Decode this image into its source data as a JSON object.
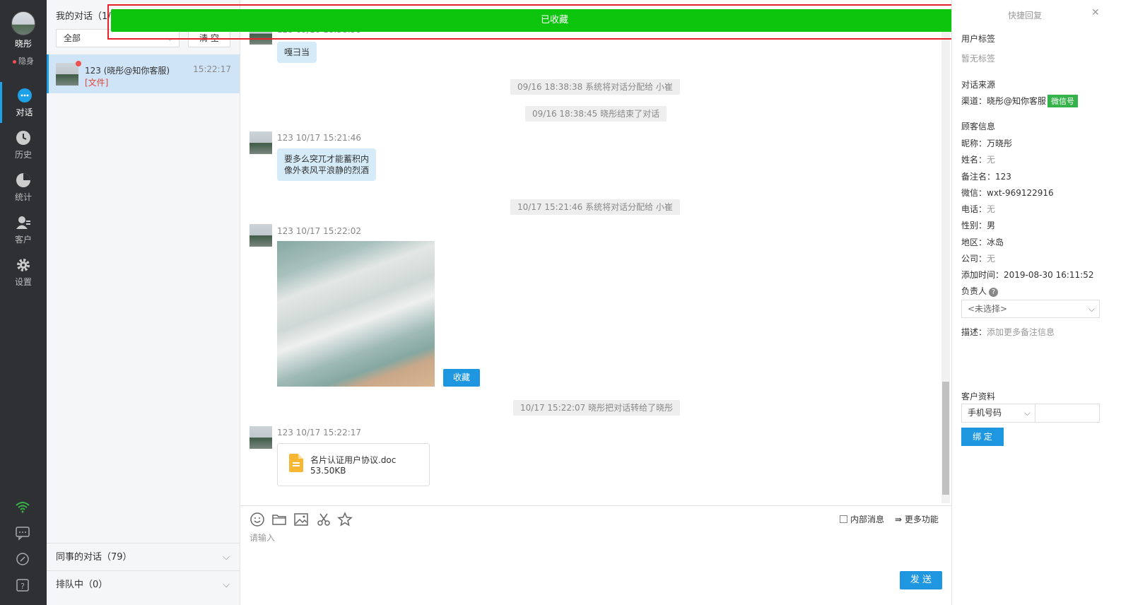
{
  "nav": {
    "user_name": "晓彤",
    "user_status": "隐身",
    "items": [
      {
        "label": "对话",
        "icon": "chat-bubble-icon"
      },
      {
        "label": "历史",
        "icon": "clock-icon"
      },
      {
        "label": "统计",
        "icon": "pie-chart-icon"
      },
      {
        "label": "客户",
        "icon": "customer-icon"
      },
      {
        "label": "设置",
        "icon": "gear-icon"
      }
    ],
    "bottom_icons": [
      "wifi-icon",
      "message-icon",
      "link-icon",
      "help-icon"
    ]
  },
  "convlist": {
    "title": "我的对话（1/",
    "filter_value": "全部",
    "clear_label": "清 空",
    "item": {
      "name": "123 (晓彤@知你客服)",
      "subtitle": "[文件]",
      "time": "15:22:17"
    },
    "colleague_label": "同事的对话（79）",
    "queue_label": "排队中（0）"
  },
  "toast": {
    "text": "已收藏",
    "color": "#0ec50e"
  },
  "chat": {
    "top_bubble": "嘎彐当",
    "top_meta_fragment": "123 09/16 18:38:38",
    "sys1": "09/16 18:38:38 系统将对话分配给 小崔",
    "sys2": "09/16 18:38:45 晓彤结束了对话",
    "msg1_meta": "123 10/17 15:21:46",
    "msg1_text_line1": "要多么突兀才能蓄积内",
    "msg1_text_line2": "像外表风平浪静的烈酒",
    "sys3": "10/17 15:21:46 系统将对话分配给 小崔",
    "msg2_meta": "123 10/17 15:22:02",
    "fav_label": "收藏",
    "sys4": "10/17 15:22:07 晓彤把对话转给了晓彤",
    "msg3_meta": "123 10/17 15:22:17",
    "file_name": "名片认证用户协议.doc",
    "file_size": "53.50KB"
  },
  "composer": {
    "tools": [
      "emoji-icon",
      "folder-icon",
      "image-icon",
      "scissors-icon",
      "star-icon"
    ],
    "internal_label": "内部消息",
    "more_label": "更多功能",
    "placeholder": "请输入",
    "send_label": "发 送"
  },
  "rpanel": {
    "quick_reply": "快捷回复",
    "user_tags": "用户标签",
    "no_tags": "暂无标签",
    "source_title": "对话来源",
    "channel_label": "渠道：晓彤@知你客服",
    "channel_badge": "微信号",
    "customer_title": "顾客信息",
    "nickname_label": "昵称：",
    "nickname_value": "万晓彤",
    "name_label": "姓名：",
    "name_value": "无",
    "remark_label": "备注名：",
    "remark_value": "123",
    "wechat_label": "微信：",
    "wechat_value": "wxt-969122916",
    "phone_label": "电话：",
    "phone_value": "无",
    "gender_label": "性别：",
    "gender_value": "男",
    "region_label": "地区：",
    "region_value": "冰岛",
    "company_label": "公司：",
    "company_value": "无",
    "added_label": "添加时间：",
    "added_value": "2019-08-30 16:11:52",
    "owner_label": "负责人",
    "owner_select": "<未选择>",
    "desc_label": "描述：",
    "desc_placeholder": "添加更多备注信息",
    "profile_title": "客户资料",
    "phone_select": "手机号码",
    "bind_label": "绑 定"
  }
}
